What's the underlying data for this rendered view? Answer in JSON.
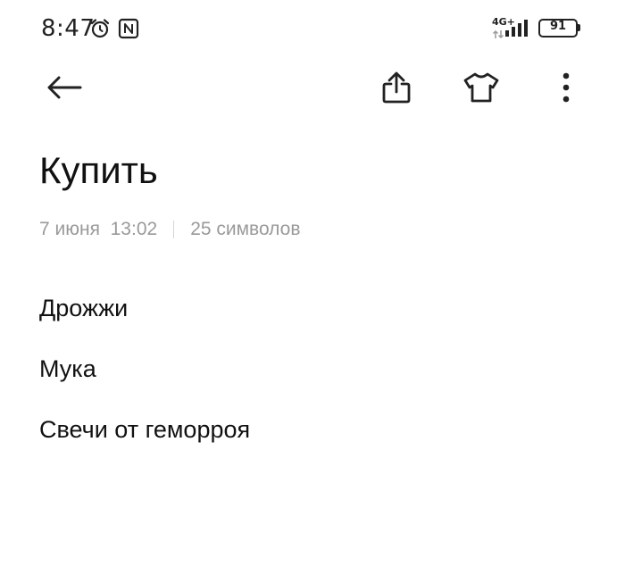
{
  "status_bar": {
    "time": "8:47",
    "network": "4G+",
    "battery": "91",
    "icons": [
      "alarm-icon",
      "nfc-icon",
      "data-arrows-icon",
      "signal-icon",
      "battery-icon"
    ]
  },
  "toolbar": {
    "icons": [
      "back-arrow-icon",
      "share-icon",
      "shirt-icon",
      "more-vertical-icon"
    ]
  },
  "note": {
    "title": "Купить",
    "date": "7 июня  13:02",
    "char_count": "25 символов",
    "lines": [
      "Дрожжи",
      "Мука",
      "Свечи от геморроя"
    ]
  },
  "colors": {
    "background": "#ffffff",
    "text": "#111111",
    "meta_text": "#9a9a9a",
    "divider": "#d6d6d6"
  }
}
